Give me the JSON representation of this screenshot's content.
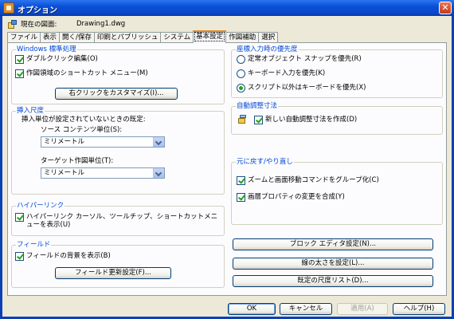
{
  "window": {
    "title": "オプション",
    "close": "✕"
  },
  "current_drawing": {
    "label": "現在の図面:",
    "value": "Drawing1.dwg"
  },
  "tabs": [
    "ファイル",
    "表示",
    "開く/保存",
    "印刷とパブリッシュ",
    "システム",
    "基本設定",
    "作図補助",
    "選択"
  ],
  "active_tab": "基本設定",
  "windows_std": {
    "title": "Windows 標準処理",
    "dblclick": "ダブルクリック編集(O)",
    "shortcut": "作図領域のショートカット メニュー(M)",
    "customize": "右クリックをカスタマイズ(I)..."
  },
  "insert_scale": {
    "title": "挿入尺度",
    "desc": "挿入単位が設定されていないときの既定:",
    "source_label": "ソース コンテンツ単位(S):",
    "source_value": "ミリメートル",
    "target_label": "ターゲット作図単位(T):",
    "target_value": "ミリメートル"
  },
  "hyperlink": {
    "title": "ハイパーリンク",
    "text": "ハイパーリンク カーソル、ツールチップ、ショートカットメニューを表示(U)"
  },
  "field": {
    "title": "フィールド",
    "bg": "フィールドの背景を表示(B)",
    "update": "フィールド更新設定(F)..."
  },
  "coord_priority": {
    "title": "座標入力時の優先度",
    "opt1": "定常オブジェクト スナップを優先(R)",
    "opt2": "キーボード入力を優先(K)",
    "opt3": "スクリプト以外はキーボードを優先(X)"
  },
  "assoc_dim": {
    "title": "自動調整寸法",
    "new": "新しい自動調整寸法を作成(D)"
  },
  "undo_redo": {
    "title": "元に戻す/やり直し",
    "zoom": "ズームと画面移動コマンドをグループ化(C)",
    "layer": "画層プロパティの変更を合成(Y)"
  },
  "right_buttons": {
    "block": "ブロック エディタ設定(N)...",
    "lineweight": "線の太さを設定(L)...",
    "scale_list": "既定の尺度リスト(D)..."
  },
  "footer": {
    "ok": "OK",
    "cancel": "キャンセル",
    "apply": "適用(A)",
    "help": "ヘルプ(H)"
  }
}
